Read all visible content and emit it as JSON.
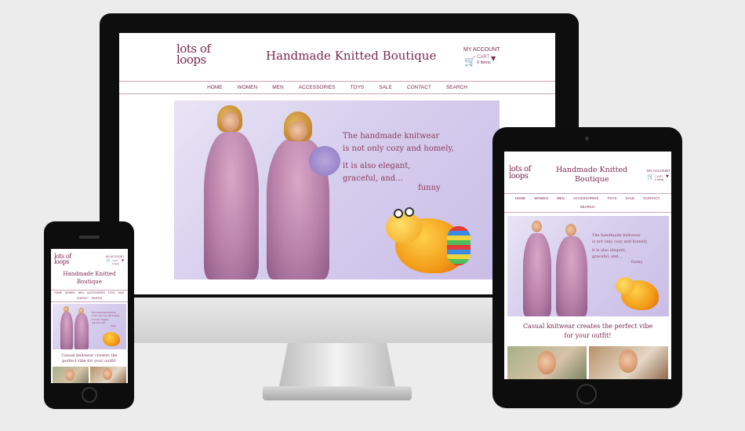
{
  "site": {
    "logo_line1": "lots of",
    "logo_line2": "loops",
    "title": "Handmade Knitted Boutique",
    "tablet_title_line1": "Handmade Knitted",
    "tablet_title_line2": "Boutique",
    "my_account": "MY ACCOUNT",
    "cart": "CART",
    "cart_items": "0 items",
    "cart_caret": "▼",
    "nav": [
      "HOME",
      "WOMEN",
      "MEN",
      "ACCESSORIES",
      "TOYS",
      "SALE",
      "CONTACT",
      "SEARCH"
    ],
    "hero_line1": "The handmade knitwear",
    "hero_line2": "is not only cozy and homely,",
    "hero_line3": "it is also elegant,",
    "hero_line4": "graceful, and...",
    "hero_line5": "funny",
    "tagline_line1": "Casual knitwear creates the perfect vibe",
    "tagline_line2": "for your outfit!",
    "phone_tagline_line1": "Casual knitwear creates the",
    "phone_tagline_line2": "perfect vibe for your outfit!"
  },
  "devices": {
    "apple_glyph": ""
  },
  "colors": {
    "brand": "#7a2a4e",
    "background": "#ececec",
    "bezel": "#0e0e0f"
  }
}
